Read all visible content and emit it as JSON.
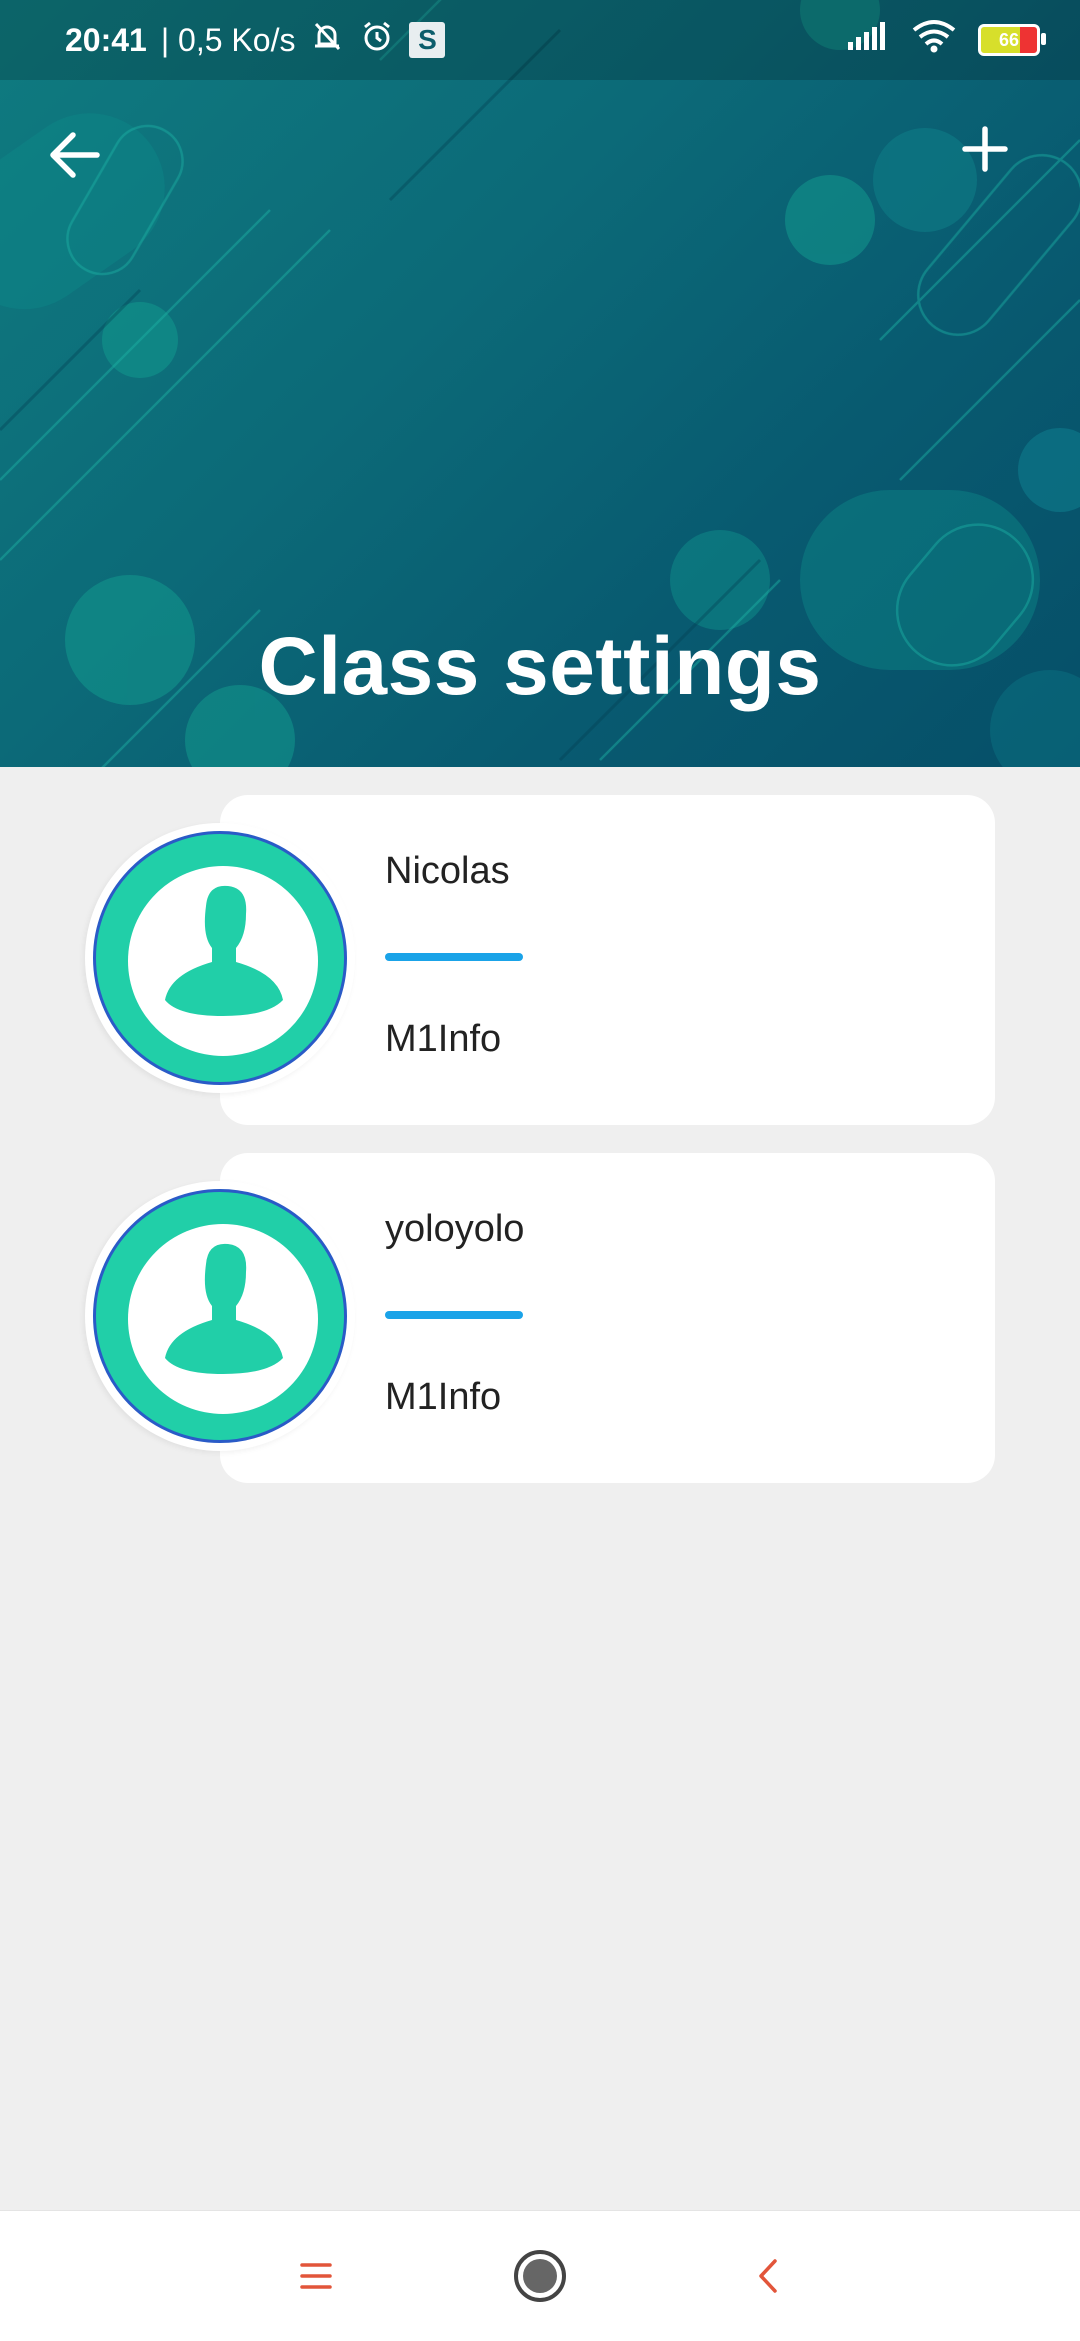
{
  "status_bar": {
    "time": "20:41",
    "speed": "| 0,5 Ko/s",
    "badge": "S",
    "battery": "66"
  },
  "header": {
    "title": "Class settings",
    "back_icon": "arrow-left-icon",
    "add_icon": "plus-icon"
  },
  "students": [
    {
      "name": "Nicolas",
      "class": "M1Info"
    },
    {
      "name": "yoloyolo",
      "class": "M1Info"
    }
  ],
  "navbar": {
    "menu_icon": "menu-icon",
    "home_icon": "home-icon",
    "back_icon": "back-chevron-icon"
  },
  "colors": {
    "header": "#0b6a78",
    "avatar": "#21cfa8",
    "avatar_border": "#2a5bc7",
    "divider": "#1aa3e8",
    "nav_accent": "#e2553a"
  }
}
